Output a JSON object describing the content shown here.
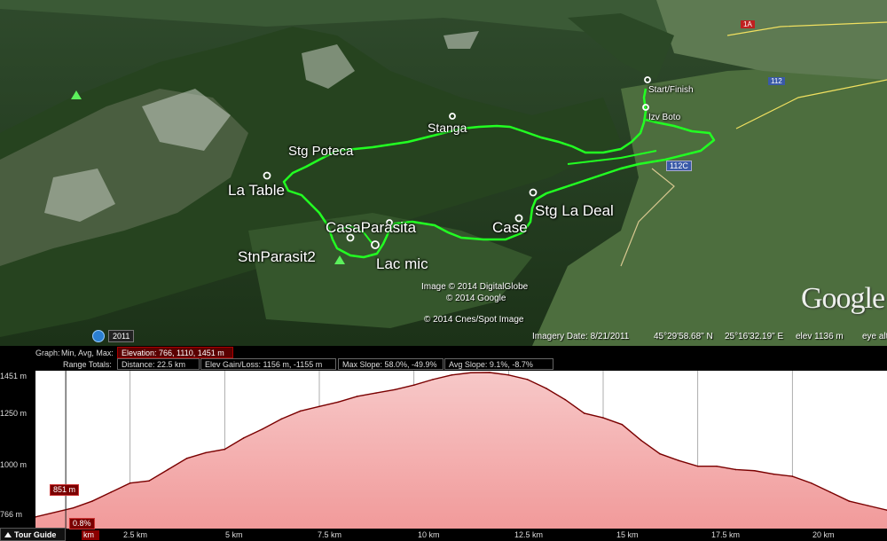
{
  "map": {
    "places": {
      "start": "Start/Finish",
      "izv": "Izv Boto",
      "stanga": "Stanga",
      "stg_poteca": "Stg Poteca",
      "la_table": "La Table",
      "casa": "CasaParasita",
      "case": "Case",
      "stg_la_deal": "Stg La Deal",
      "stn": "StnParasit2",
      "lac": "Lac mic"
    },
    "roads": [
      "112C",
      "1A",
      "112"
    ],
    "credits": [
      "Image © 2014 DigitalGlobe",
      "© 2014 Google",
      "© 2014 Cnes/Spot Image"
    ],
    "logo": "Google",
    "year": "2011",
    "status": {
      "imagery": "Imagery Date: 8/21/2011",
      "lat": "45°29'58.68\" N",
      "lon": "25°16'32.19\" E",
      "elev": "elev  1136 m",
      "eye": "eye alt"
    },
    "colors": {
      "track": "#22ff22"
    }
  },
  "panel": {
    "graph_label": "Graph:",
    "graph_value": "Min, Avg, Max:",
    "elevation": "Elevation: 766, 1110, 1451 m",
    "range_label": "Range Totals:",
    "distance": "Distance: 22.5 km",
    "gain_loss": "Elev Gain/Loss: 1156 m, -1155 m",
    "max_slope": "Max Slope: 58.0%, -49.9%",
    "avg_slope": "Avg Slope: 9.1%, -8.7%",
    "cursor_value": "851 m",
    "cursor_pct": "0.8%",
    "tour_guide": "Tour Guide",
    "km0": "km"
  },
  "chart_data": {
    "type": "area",
    "xlabel": "",
    "ylabel": "",
    "yticks": [
      "1451 m",
      "1250 m",
      "1000 m",
      "766 m"
    ],
    "xticks": [
      "2.5 km",
      "5 km",
      "7.5 km",
      "10 km",
      "12.5 km",
      "15 km",
      "17.5 km",
      "20 km"
    ],
    "xlim": [
      0,
      22.5
    ],
    "ylim": [
      766,
      1451
    ],
    "grid": true,
    "x": [
      0,
      1,
      1.5,
      2,
      2.5,
      3,
      3.5,
      4,
      4.5,
      5,
      5.5,
      6,
      6.5,
      7,
      7.5,
      8,
      8.5,
      9,
      9.5,
      10,
      10.5,
      11,
      11.5,
      12,
      12.5,
      13,
      13.5,
      14,
      14.5,
      15,
      15.5,
      16,
      16.5,
      17,
      17.5,
      18,
      18.5,
      19,
      19.5,
      20,
      20.5,
      21,
      21.5,
      22,
      22.5
    ],
    "y": [
      810,
      850,
      880,
      920,
      960,
      970,
      1020,
      1070,
      1095,
      1110,
      1160,
      1200,
      1245,
      1280,
      1300,
      1320,
      1345,
      1360,
      1375,
      1395,
      1420,
      1440,
      1450,
      1451,
      1440,
      1420,
      1380,
      1330,
      1270,
      1250,
      1220,
      1150,
      1090,
      1060,
      1035,
      1035,
      1020,
      1015,
      1000,
      990,
      960,
      920,
      880,
      860,
      840
    ]
  }
}
